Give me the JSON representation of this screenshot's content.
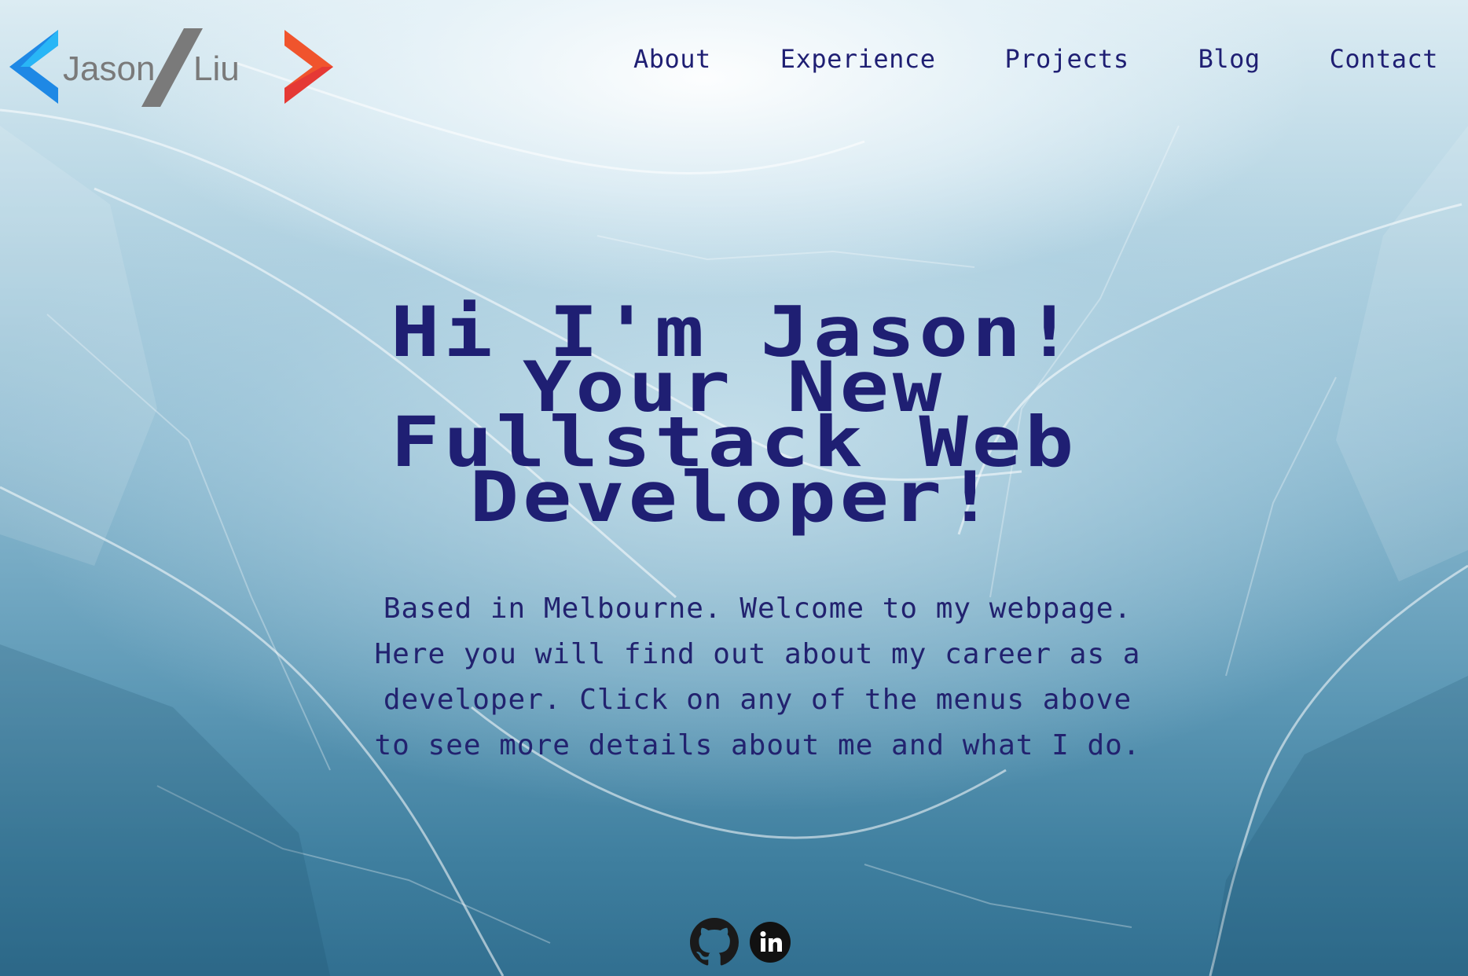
{
  "logo": {
    "first_name": "Jason",
    "last_name": "Liu",
    "colors": {
      "left_bracket": "#1e88e5",
      "slash": "#7a7a7a",
      "text": "#7a7a7a",
      "right_bracket": "#f0542d"
    }
  },
  "nav": {
    "items": [
      {
        "label": "About"
      },
      {
        "label": "Experience"
      },
      {
        "label": "Projects"
      },
      {
        "label": "Blog"
      },
      {
        "label": "Contact"
      }
    ]
  },
  "hero": {
    "title_lines": [
      "Hi I'm Jason!",
      "Your New",
      "Fullstack Web",
      "Developer!"
    ],
    "description": "Based in Melbourne. Welcome to my webpage. Here you will find out about my career as a developer. Click on any of the menus above to see more details about me and what I do."
  },
  "social": {
    "icons": [
      "github-icon",
      "linkedin-icon"
    ]
  },
  "colors": {
    "text": "#1f1f73",
    "background_top": "#dcecf3",
    "background_bottom": "#316f90"
  }
}
